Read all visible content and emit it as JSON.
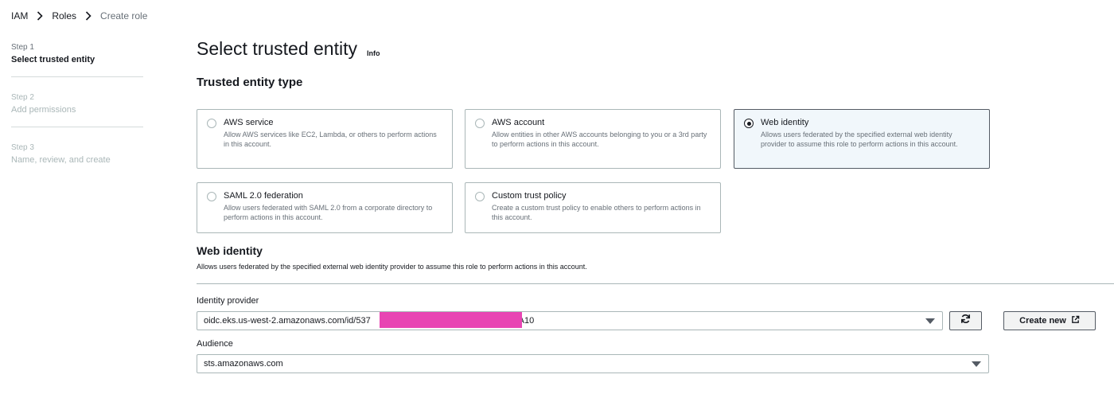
{
  "breadcrumb": {
    "items": [
      "IAM",
      "Roles",
      "Create role"
    ]
  },
  "steps": [
    {
      "num": "Step 1",
      "name": "Select trusted entity"
    },
    {
      "num": "Step 2",
      "name": "Add permissions"
    },
    {
      "num": "Step 3",
      "name": "Name, review, and create"
    }
  ],
  "page": {
    "title": "Select trusted entity",
    "info": "Info",
    "section_title": "Trusted entity type"
  },
  "tiles": [
    {
      "title": "AWS service",
      "desc": "Allow AWS services like EC2, Lambda, or others to perform actions in this account."
    },
    {
      "title": "AWS account",
      "desc": "Allow entities in other AWS accounts belonging to you or a 3rd party to perform actions in this account."
    },
    {
      "title": "Web identity",
      "desc": "Allows users federated by the specified external web identity provider to assume this role to perform actions in this account."
    },
    {
      "title": "SAML 2.0 federation",
      "desc": "Allow users federated with SAML 2.0 from a corporate directory to perform actions in this account."
    },
    {
      "title": "Custom trust policy",
      "desc": "Create a custom trust policy to enable others to perform actions in this account."
    }
  ],
  "web_identity": {
    "title": "Web identity",
    "desc": "Allows users federated by the specified external web identity provider to assume this role to perform actions in this account.",
    "provider_label": "Identity provider",
    "provider_value_prefix": "oidc.eks.us-west-2.amazonaws.com/id/537",
    "provider_value_suffix": "DA10",
    "create_new_label": "Create new",
    "audience_label": "Audience",
    "audience_value": "sts.amazonaws.com"
  },
  "colors": {
    "redaction": "#e845b3",
    "selected_tile_bg": "#f1f7fb"
  }
}
